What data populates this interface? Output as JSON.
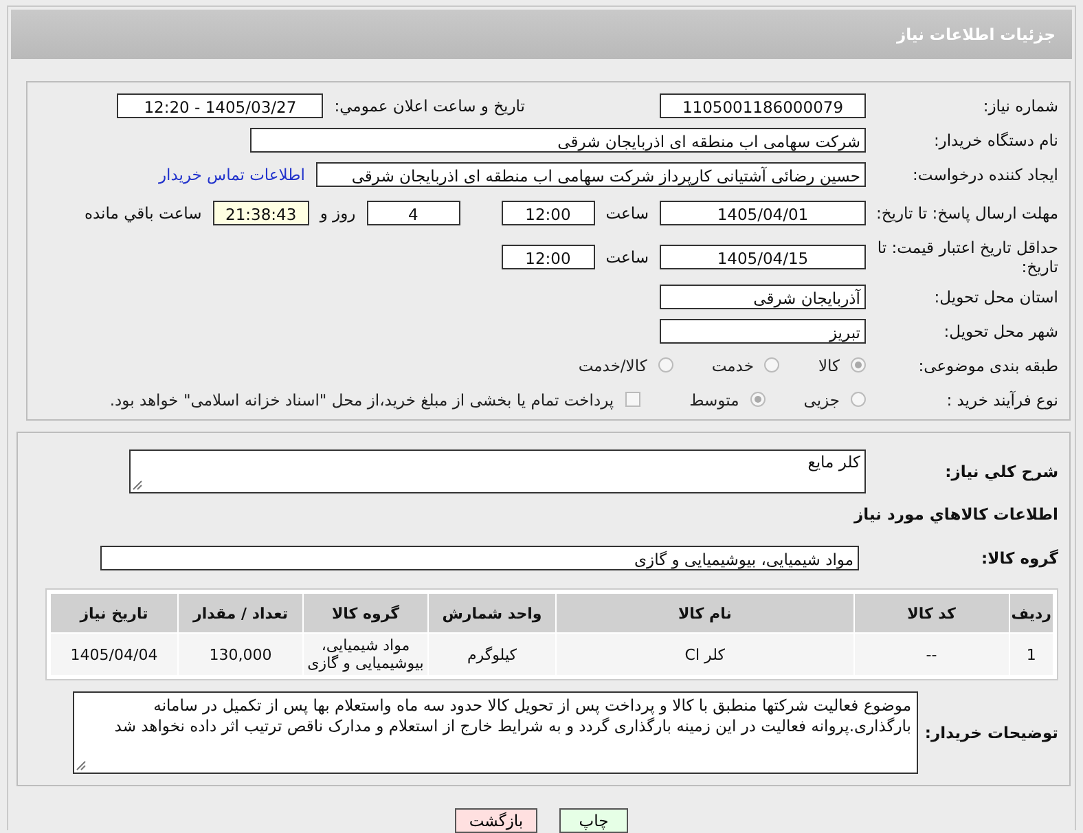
{
  "header": {
    "title": "جزئیات اطلاعات نیاز"
  },
  "need_number": {
    "label": "شماره نیاز:",
    "value": "1105001186000079"
  },
  "announce": {
    "label": "تاریخ و ساعت اعلان عمومي:",
    "value": "1405/03/27 - 12:20"
  },
  "buyer_org": {
    "label": "نام دستگاه خریدار:",
    "value": "شرکت سهامی اب منطقه ای اذربایجان شرقی"
  },
  "requester": {
    "label": "ایجاد کننده درخواست:",
    "value": "حسین رضائی آشتیانی کارپرداز شرکت سهامی اب منطقه ای اذربایجان شرقی",
    "link": "اطلاعات تماس خریدار"
  },
  "reply_deadline": {
    "label": "مهلت ارسال پاسخ: تا تاریخ:",
    "date": "1405/04/01",
    "time_label": "ساعت",
    "time": "12:00",
    "days": "4",
    "days_label": "روز و",
    "remaining": "21:38:43",
    "remaining_label": "ساعت باقي مانده"
  },
  "price_validity": {
    "label": "حداقل تاریخ اعتبار قیمت: تا تاریخ:",
    "date": "1405/04/15",
    "time_label": "ساعت",
    "time": "12:00"
  },
  "province": {
    "label": "استان محل تحویل:",
    "value": "آذربایجان شرقی"
  },
  "city": {
    "label": "شهر محل تحویل:",
    "value": "تبریز"
  },
  "category": {
    "label": "طبقه بندی موضوعی:",
    "options": [
      {
        "label": "کالا",
        "selected": true
      },
      {
        "label": "خدمت",
        "selected": false
      },
      {
        "label": "کالا/خدمت",
        "selected": false
      }
    ]
  },
  "process": {
    "label": "نوع فرآیند خرید :",
    "options": [
      {
        "label": "جزیی",
        "selected": false
      },
      {
        "label": "متوسط",
        "selected": true
      }
    ],
    "payment": {
      "label": "پرداخت تمام یا بخشی از مبلغ خرید،از محل \"اسناد خزانه اسلامی\" خواهد بود.",
      "checked": false
    }
  },
  "description": {
    "label": "شرح كلي نياز:",
    "value": "كلر مايع"
  },
  "goods_heading": "اطلاعات كالاهاي مورد نياز",
  "goods_group": {
    "label": "گروه کالا:",
    "value": "مواد شیمیایی، بیوشیمیایی و گازی"
  },
  "table": {
    "columns": [
      "ردیف",
      "کد کالا",
      "نام کالا",
      "واحد شمارش",
      "گروه کالا",
      "تعداد / مقدار",
      "تاریخ نیاز"
    ],
    "rows": [
      [
        "1",
        "--",
        "کلر Cl",
        "کیلوگرم",
        "مواد شیمیایی، بیوشیمیایی و گازی",
        "130,000",
        "1405/04/04"
      ]
    ]
  },
  "buyer_notes": {
    "label": "توضیحات خریدار:",
    "value": "موضوع فعالیت شرکتها منطبق با کالا و پرداخت پس از تحویل کالا حدود سه ماه واستعلام بها پس از تکمیل در سامانه بارگذاری.پروانه فعالیت در این زمینه بارگذاری گردد و به شرایط خارج از استعلام و مدارک ناقص ترتیب اثر داده نخواهد شد"
  },
  "buttons": [
    {
      "label": "چاپ",
      "kind": "print"
    },
    {
      "label": "بازگشت",
      "kind": "back"
    }
  ]
}
